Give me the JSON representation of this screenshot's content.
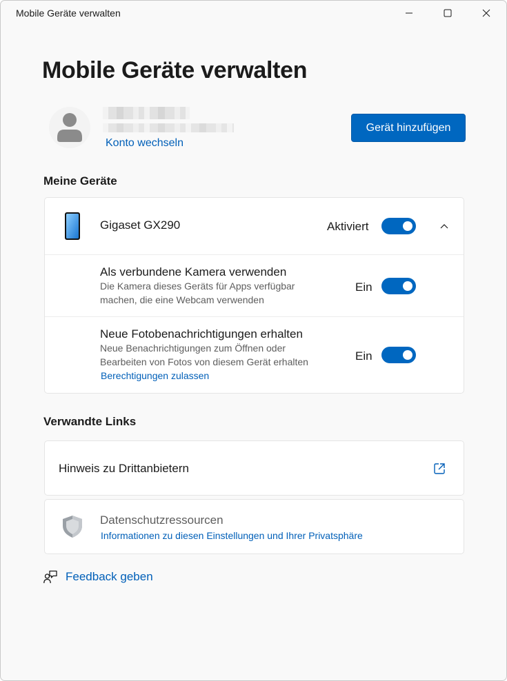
{
  "window": {
    "title": "Mobile Geräte verwalten"
  },
  "page": {
    "title": "Mobile Geräte verwalten"
  },
  "account": {
    "switch_label": "Konto wechseln",
    "add_device_label": "Gerät hinzufügen"
  },
  "my_devices": {
    "heading": "Meine Geräte",
    "device": {
      "name": "Gigaset GX290",
      "status_label": "Aktiviert",
      "enabled": true
    },
    "options": [
      {
        "title": "Als verbundene Kamera verwenden",
        "description": "Die Kamera dieses Geräts für Apps verfügbar machen, die eine Webcam verwenden",
        "state_label": "Ein",
        "enabled": true
      },
      {
        "title": "Neue Fotobenachrichtigungen erhalten",
        "description": "Neue Benachrichtigungen zum Öffnen oder Bearbeiten von Fotos von diesem Gerät erhalten",
        "state_label": "Ein",
        "enabled": true,
        "link": "Berechtigungen zulassen"
      }
    ]
  },
  "related_links": {
    "heading": "Verwandte Links",
    "third_party": "Hinweis zu Drittanbietern",
    "privacy_title": "Datenschutzressourcen",
    "privacy_link": "Informationen zu diesen Einstellungen und Ihrer Privatsphäre"
  },
  "feedback": {
    "label": "Feedback geben"
  },
  "colors": {
    "accent": "#0067c0",
    "link": "#005fb8",
    "background": "#f9f9f9",
    "card": "#ffffff"
  },
  "icons": [
    "minimize-icon",
    "maximize-icon",
    "close-icon",
    "avatar-icon",
    "phone-icon",
    "chevron-up-icon",
    "external-link-icon",
    "shield-icon",
    "feedback-icon"
  ]
}
